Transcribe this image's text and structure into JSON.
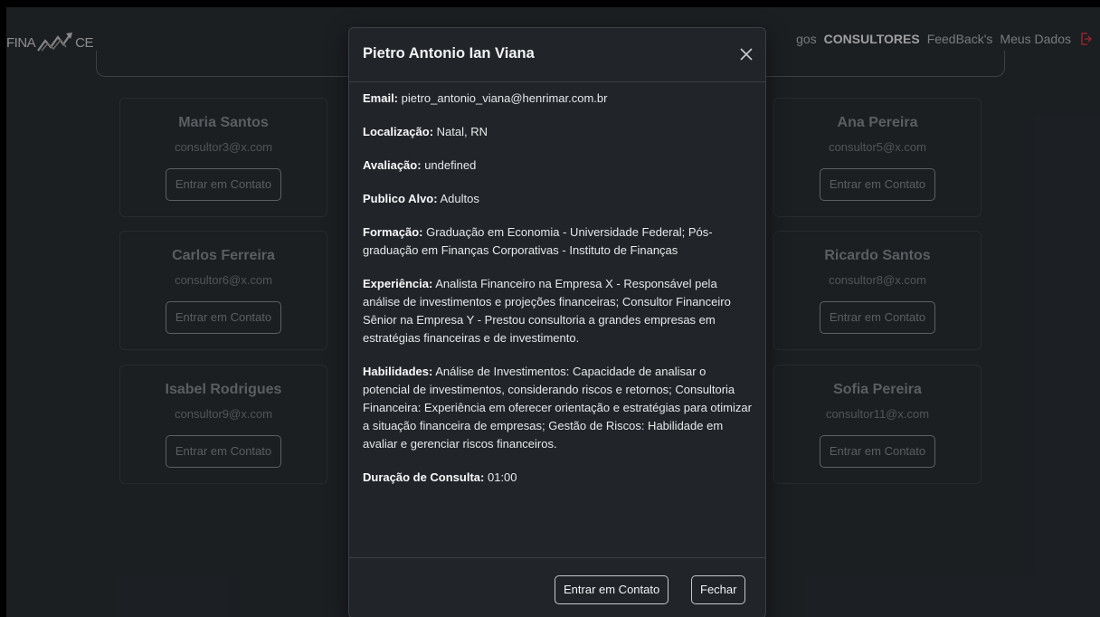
{
  "brand": {
    "text_left": "FINA",
    "text_right": "CE"
  },
  "nav": {
    "items": [
      {
        "label": "gos",
        "active": false
      },
      {
        "label": "CONSULTORES",
        "active": true
      },
      {
        "label": "FeedBack's",
        "active": false
      },
      {
        "label": "Meus Dados",
        "active": false
      }
    ]
  },
  "cards": [
    {
      "name": "Maria Santos",
      "email": "consultor3@x.com",
      "button": "Entrar em Contato"
    },
    {
      "name": "Ana Pereira",
      "email": "consultor5@x.com",
      "button": "Entrar em Contato"
    },
    {
      "name": "Carlos Ferreira",
      "email": "consultor6@x.com",
      "button": "Entrar em Contato"
    },
    {
      "name": "Ricardo Santos",
      "email": "consultor8@x.com",
      "button": "Entrar em Contato"
    },
    {
      "name": "Isabel Rodrigues",
      "email": "consultor9@x.com",
      "button": "Entrar em Contato"
    },
    {
      "name": "Sofia Pereira",
      "email": "consultor11@x.com",
      "button": "Entrar em Contato"
    }
  ],
  "modal": {
    "title": "Pietro Antonio Ian Viana",
    "fields": [
      {
        "label": "Email:",
        "value": "pietro_antonio_viana@henrimar.com.br"
      },
      {
        "label": "Localização:",
        "value": "Natal, RN"
      },
      {
        "label": "Avaliação:",
        "value": "undefined"
      },
      {
        "label": "Publico Alvo:",
        "value": "Adultos"
      },
      {
        "label": "Formação:",
        "value": "Graduação em Economia - Universidade Federal; Pós-graduação em Finanças Corporativas - Instituto de Finanças"
      },
      {
        "label": "Experiência:",
        "value": "Analista Financeiro na Empresa X - Responsável pela análise de investimentos e projeções financeiras; Consultor Financeiro Sênior na Empresa Y - Prestou consultoria a grandes empresas em estratégias financeiras e de investimento."
      },
      {
        "label": "Habilidades:",
        "value": "Análise de Investimentos: Capacidade de analisar o potencial de investimentos, considerando riscos e retornos; Consultoria Financeira: Experiência em oferecer orientação e estratégias para otimizar a situação financeira de empresas; Gestão de Riscos: Habilidade em avaliar e gerenciar riscos financeiros."
      },
      {
        "label": "Duração de Consulta:",
        "value": "01:00"
      }
    ],
    "contact_button": "Entrar em Contato",
    "close_button": "Fechar"
  },
  "colors": {
    "logout_icon": "#dc3545",
    "background": "#2b3035",
    "modal": "#212529"
  },
  "icons": {
    "close": "close-icon",
    "logout": "logout-icon",
    "logo": "logo-chart-icon"
  }
}
